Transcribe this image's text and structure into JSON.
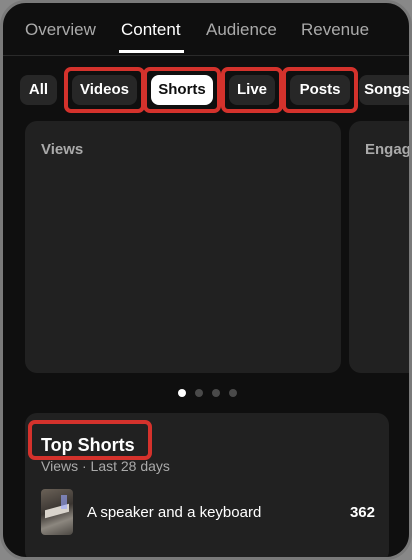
{
  "tabs": [
    {
      "label": "Overview",
      "active": false
    },
    {
      "label": "Content",
      "active": true
    },
    {
      "label": "Audience",
      "active": false
    },
    {
      "label": "Revenue",
      "active": false
    }
  ],
  "chips": [
    {
      "label": "All",
      "active": false,
      "highlighted": false
    },
    {
      "label": "Videos",
      "active": false,
      "highlighted": true
    },
    {
      "label": "Shorts",
      "active": true,
      "highlighted": true
    },
    {
      "label": "Live",
      "active": false,
      "highlighted": true
    },
    {
      "label": "Posts",
      "active": false,
      "highlighted": true
    },
    {
      "label": "Songs",
      "active": false,
      "highlighted": false
    }
  ],
  "cards": [
    {
      "title": "Views"
    },
    {
      "title": "Engagement"
    }
  ],
  "carousel": {
    "page_count": 4,
    "active_index": 0
  },
  "top_shorts": {
    "title": "Top Shorts",
    "subtitle": "Views · Last 28 days",
    "title_highlighted": true,
    "items": [
      {
        "title": "A speaker and a keyboard",
        "value": "362",
        "thumbnail_icon": "video-thumbnail"
      }
    ]
  },
  "colors": {
    "background": "#0f0f0f",
    "card": "#212121",
    "chip": "#272727",
    "highlight": "#d4322c"
  }
}
